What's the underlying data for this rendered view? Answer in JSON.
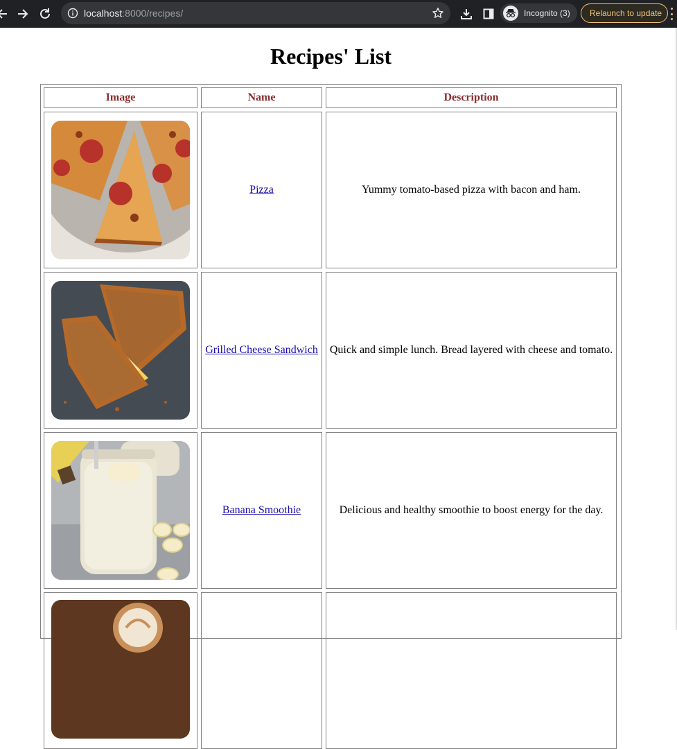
{
  "browser": {
    "url_host": "localhost",
    "url_rest": ":8000/recipes/",
    "incognito_label": "Incognito (3)",
    "relaunch_label": "Relaunch to update"
  },
  "page": {
    "title": "Recipes' List"
  },
  "table": {
    "headers": [
      "Image",
      "Name",
      "Description"
    ],
    "rows": [
      {
        "name": "Pizza",
        "description": "Yummy tomato-based pizza with bacon and ham.",
        "image": "pizza-photo"
      },
      {
        "name": "Grilled Cheese Sandwich",
        "description": "Quick and simple lunch. Bread layered with cheese and tomato.",
        "image": "grilled-cheese-photo"
      },
      {
        "name": "Banana Smoothie",
        "description": "Delicious and healthy smoothie to boost energy for the day.",
        "image": "banana-smoothie-photo"
      },
      {
        "name": "",
        "description": "",
        "image": "coffee-photo"
      }
    ]
  },
  "colors": {
    "chrome_bg": "#202124",
    "header_text": "#8b2c2c",
    "link": "#1a0dab",
    "relaunch": "#f2c27a"
  }
}
